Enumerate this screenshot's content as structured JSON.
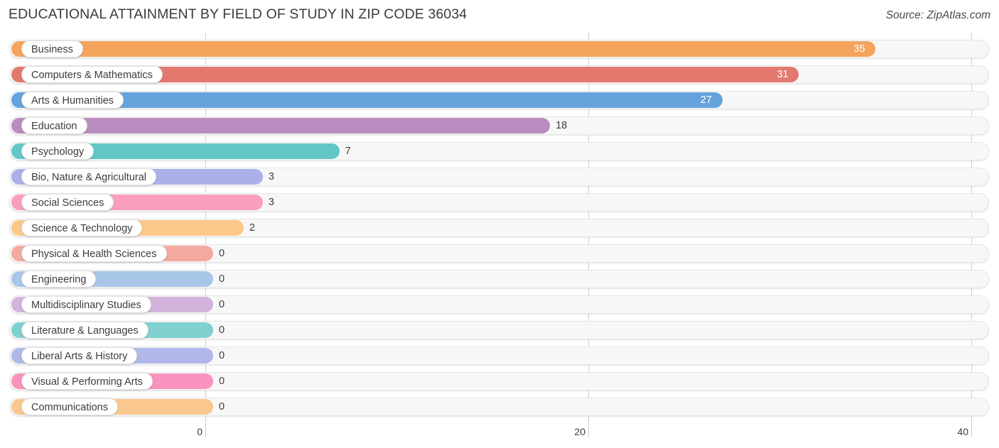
{
  "header": {
    "title": "EDUCATIONAL ATTAINMENT BY FIELD OF STUDY IN ZIP CODE 36034",
    "source": "Source: ZipAtlas.com"
  },
  "chart_data": {
    "type": "bar",
    "orientation": "horizontal",
    "title": "EDUCATIONAL ATTAINMENT BY FIELD OF STUDY IN ZIP CODE 36034",
    "xlabel": "",
    "ylabel": "",
    "xlim": [
      0,
      40
    ],
    "ticks": [
      "0",
      "20",
      "40"
    ],
    "tick_values": [
      0,
      20,
      40
    ],
    "grid": true,
    "legend": false,
    "categories": [
      "Business",
      "Computers & Mathematics",
      "Arts & Humanities",
      "Education",
      "Psychology",
      "Bio, Nature & Agricultural",
      "Social Sciences",
      "Science & Technology",
      "Physical & Health Sciences",
      "Engineering",
      "Multidisciplinary Studies",
      "Literature & Languages",
      "Liberal Arts & History",
      "Visual & Performing Arts",
      "Communications"
    ],
    "values": [
      35,
      31,
      27,
      18,
      7,
      3,
      3,
      2,
      0,
      0,
      0,
      0,
      0,
      0,
      0
    ],
    "value_labels": [
      "35",
      "31",
      "27",
      "18",
      "7",
      "3",
      "3",
      "2",
      "0",
      "0",
      "0",
      "0",
      "0",
      "0",
      "0"
    ],
    "colors": [
      "#F5A45D",
      "#E2786E",
      "#65A3DC",
      "#BA8CC0",
      "#63C7C8",
      "#ABB1E8",
      "#F99EBF",
      "#FBC88A",
      "#F4A9A0",
      "#A8C6E8",
      "#D3B3DC",
      "#7FD0CF",
      "#AFB8E8",
      "#F992BC",
      "#FAC78E"
    ]
  }
}
